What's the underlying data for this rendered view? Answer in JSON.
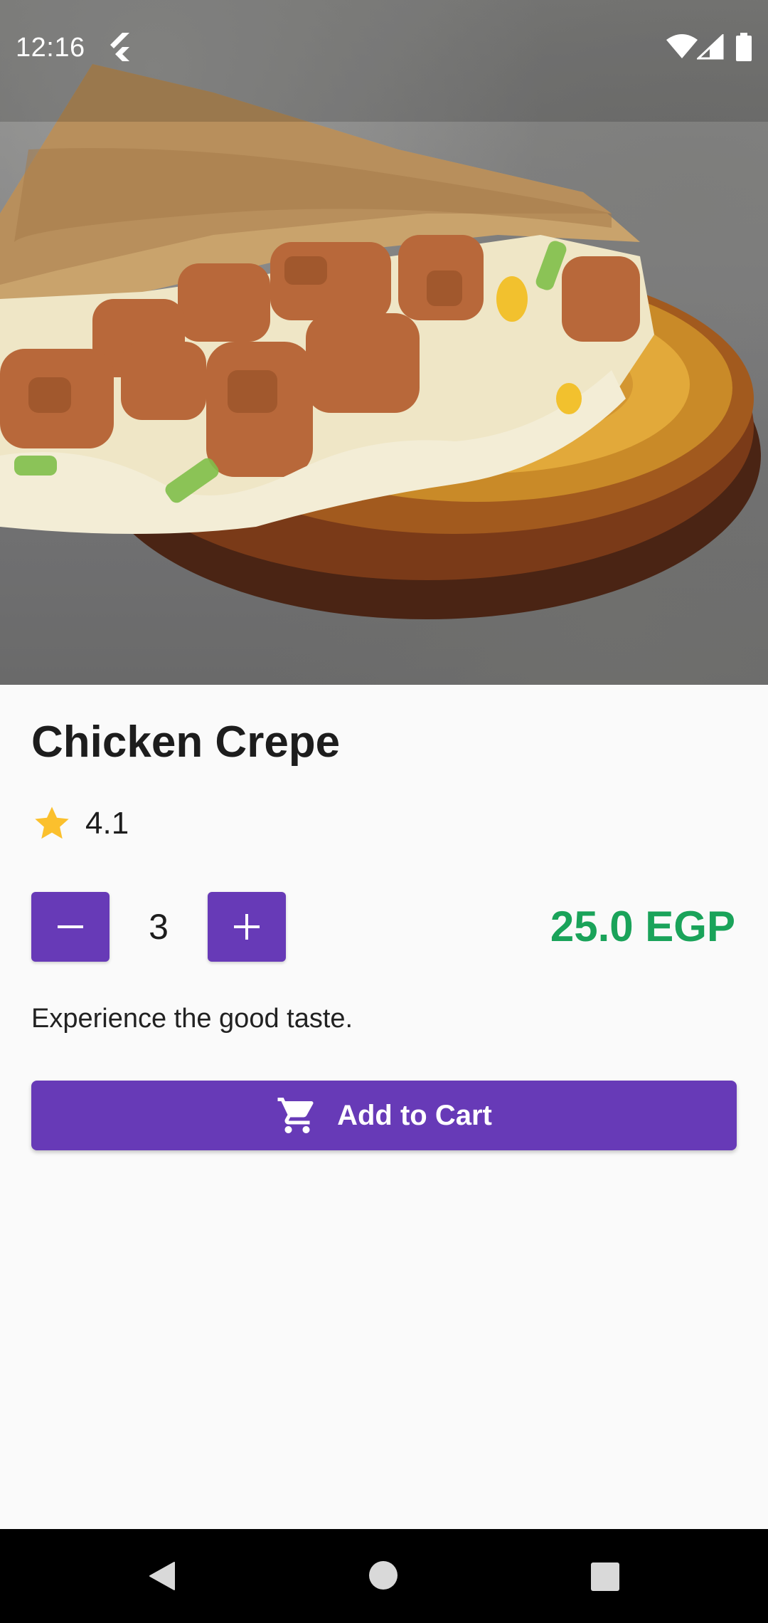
{
  "status_bar": {
    "time": "12:16",
    "icons": [
      "flutter-icon",
      "wifi-icon",
      "cellular-signal-icon",
      "battery-icon"
    ]
  },
  "hero": {
    "icon": "food-photo-icon"
  },
  "product": {
    "name": "Chicken Crepe",
    "rating": "4.1",
    "quantity": "3",
    "price": "25.0 EGP",
    "description": "Experience the good taste."
  },
  "actions": {
    "decrease_icon": "minus-icon",
    "increase_icon": "plus-icon",
    "add_to_cart_label": "Add to Cart",
    "add_to_cart_icon": "shopping-cart-icon"
  },
  "nav_bar": {
    "icons": [
      "back-icon",
      "home-icon",
      "recents-icon"
    ]
  },
  "colors": {
    "accent": "#673ab7",
    "price": "#1aa35a",
    "star": "#fbc02d",
    "background": "#fafafa"
  }
}
